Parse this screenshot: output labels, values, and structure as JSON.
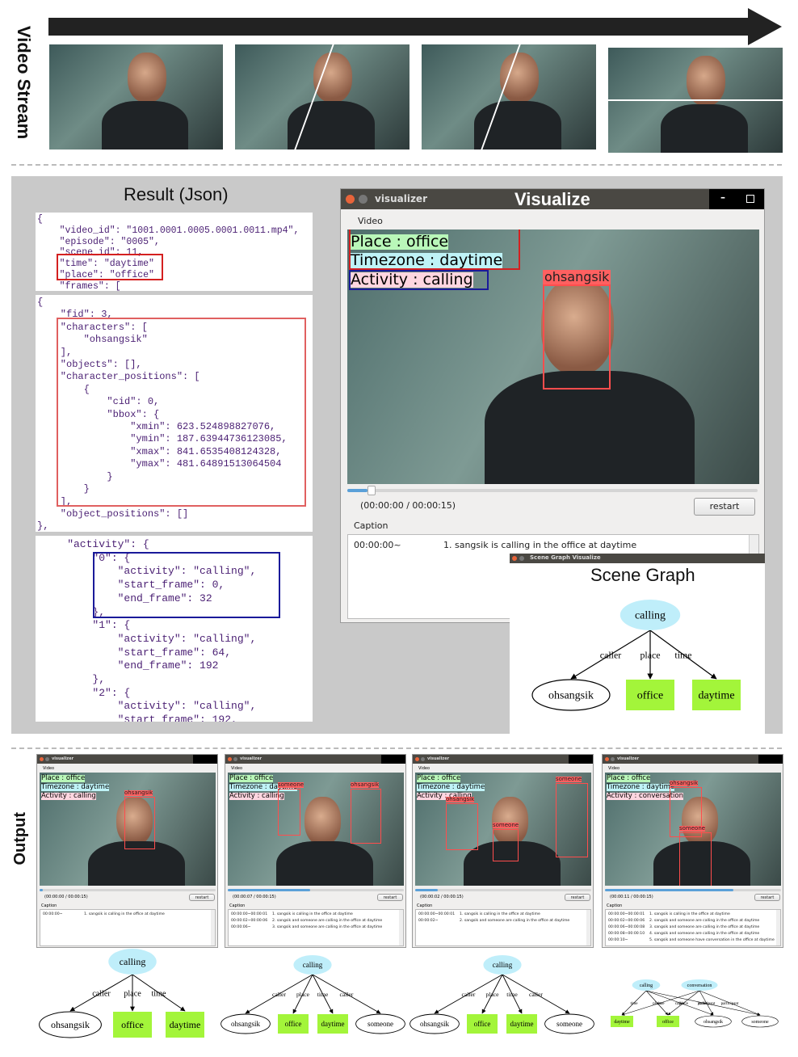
{
  "labels": {
    "video_stream": "Video Stream",
    "output": "Output",
    "result_json": "Result (Json)",
    "visualize": "Visualize",
    "scene_graph": "Scene Graph"
  },
  "json_result": {
    "box1": [
      "{",
      "    \"video_id\": \"1001.0001.0005.0001.0011.mp4\",",
      "    \"episode\": \"0005\",",
      "    \"scene_id\": 11,",
      "    \"time\": \"daytime\"",
      "    \"place\": \"office\"",
      "    \"frames\": ["
    ],
    "box2": [
      "{",
      "    \"fid\": 3,",
      "    \"characters\": [",
      "        \"ohsangsik\"",
      "    ],",
      "    \"objects\": [],",
      "    \"character_positions\": [",
      "        {",
      "            \"cid\": 0,",
      "            \"bbox\": {",
      "                \"xmin\": 623.524898827076,",
      "                \"ymin\": 187.63944736123085,",
      "                \"xmax\": 841.6535408124328,",
      "                \"ymax\": 481.64891513064504",
      "            }",
      "        }",
      "    ],",
      "    \"object_positions\": []",
      "},"
    ],
    "box3": [
      "    \"activity\": {",
      "        \"0\": {",
      "            \"activity\": \"calling\",",
      "            \"start_frame\": 0,",
      "            \"end_frame\": 32",
      "        },",
      "        \"1\": {",
      "            \"activity\": \"calling\",",
      "            \"start_frame\": 64,",
      "            \"end_frame\": 192",
      "        },",
      "        \"2\": {",
      "            \"activity\": \"calling\",",
      "            \"start_frame\": 192,"
    ]
  },
  "visualizer": {
    "window_title": "visualizer",
    "menu": "Video",
    "place": "Place : office",
    "timezone": "Timezone : daytime",
    "activity": "Activity : calling",
    "person": "ohsangsik",
    "time_readout": "(00:00:00 / 00:00:15)",
    "progress": 0.05,
    "restart": "restart",
    "caption_label": "Caption",
    "captions": [
      {
        "time": "00:00:00~",
        "text": "1. sangsik is calling in the office at daytime"
      }
    ]
  },
  "scene_graph_window": {
    "window_title": "Scene Graph Visualize"
  },
  "graph_main": {
    "nodes": [
      {
        "id": "calling",
        "type": "activity"
      },
      {
        "id": "ohsangsik",
        "type": "person"
      },
      {
        "id": "office",
        "type": "attr"
      },
      {
        "id": "daytime",
        "type": "attr"
      }
    ],
    "edges": [
      {
        "from": "calling",
        "to": "ohsangsik",
        "label": "caller"
      },
      {
        "from": "calling",
        "to": "office",
        "label": "place"
      },
      {
        "from": "calling",
        "to": "daytime",
        "label": "time"
      }
    ]
  },
  "outputs": [
    {
      "window_title": "visualizer",
      "menu": "Video",
      "place": "Place : office",
      "timezone": "Timezone : daytime",
      "activity": "Activity : calling",
      "persons": [
        "ohsangsik"
      ],
      "time_readout": "(00:00:00 / 00:00:15)",
      "progress": 0.02,
      "restart": "restart",
      "caption_label": "Caption",
      "captions": [
        {
          "time": "00:00:00~",
          "text": "1. sangsik is calling in the office at daytime"
        }
      ],
      "graph": {
        "nodes": [
          {
            "id": "calling",
            "type": "activity"
          },
          {
            "id": "ohsangsik",
            "type": "person"
          },
          {
            "id": "office",
            "type": "attr"
          },
          {
            "id": "daytime",
            "type": "attr"
          }
        ],
        "edges": [
          {
            "from": "calling",
            "to": "ohsangsik",
            "label": "caller"
          },
          {
            "from": "calling",
            "to": "office",
            "label": "place"
          },
          {
            "from": "calling",
            "to": "daytime",
            "label": "time"
          }
        ]
      }
    },
    {
      "window_title": "visualizer",
      "menu": "Video",
      "place": "Place : office",
      "timezone": "Timezone : daytime",
      "activity": "Activity : calling",
      "persons": [
        "someone",
        "ohsangsik"
      ],
      "time_readout": "(00:00:07 / 00:00:15)",
      "progress": 0.47,
      "restart": "restart",
      "caption_label": "Caption",
      "captions": [
        {
          "time": "00:00:00~00:00:01",
          "text": "1. sangsik is calling in the office at daytime"
        },
        {
          "time": "00:00:02~00:00:06",
          "text": "2. sangsik and someone are calling in the office at daytime"
        },
        {
          "time": "00:00:06~",
          "text": "3. sangsik and someone are calling in the office at daytime"
        }
      ],
      "graph": {
        "nodes": [
          {
            "id": "calling",
            "type": "activity"
          },
          {
            "id": "ohsangsik",
            "type": "person"
          },
          {
            "id": "office",
            "type": "attr"
          },
          {
            "id": "daytime",
            "type": "attr"
          },
          {
            "id": "someone",
            "type": "person"
          }
        ],
        "edges": [
          {
            "from": "calling",
            "to": "ohsangsik",
            "label": "caller"
          },
          {
            "from": "calling",
            "to": "office",
            "label": "place"
          },
          {
            "from": "calling",
            "to": "daytime",
            "label": "time"
          },
          {
            "from": "calling",
            "to": "someone",
            "label": "caller"
          }
        ]
      }
    },
    {
      "window_title": "visualizer",
      "menu": "Video",
      "place": "Place : office",
      "timezone": "Timezone : daytime",
      "activity": "Activity : calling",
      "persons": [
        "someone",
        "ohsangsik",
        "someone"
      ],
      "time_readout": "(00:00:02 / 00:00:15)",
      "progress": 0.13,
      "restart": "restart",
      "caption_label": "Caption",
      "captions": [
        {
          "time": "00:00:00~00:00:01",
          "text": "1. sangsik is calling in the office at daytime"
        },
        {
          "time": "00:00:02~",
          "text": "2. sangsik and someone are calling in the office at daytime"
        }
      ],
      "graph": {
        "nodes": [
          {
            "id": "calling",
            "type": "activity"
          },
          {
            "id": "ohsangsik",
            "type": "person"
          },
          {
            "id": "office",
            "type": "attr"
          },
          {
            "id": "daytime",
            "type": "attr"
          },
          {
            "id": "someone",
            "type": "person"
          }
        ],
        "edges": [
          {
            "from": "calling",
            "to": "ohsangsik",
            "label": "caller"
          },
          {
            "from": "calling",
            "to": "office",
            "label": "place"
          },
          {
            "from": "calling",
            "to": "daytime",
            "label": "time"
          },
          {
            "from": "calling",
            "to": "someone",
            "label": "caller"
          }
        ]
      }
    },
    {
      "window_title": "visualizer",
      "menu": "Video",
      "place": "Place : office",
      "timezone": "Timezone : daytime",
      "activity": "Activity : conversation",
      "persons": [
        "ohsangsik",
        "someone"
      ],
      "time_readout": "(00:00:11 / 00:00:15)",
      "progress": 0.73,
      "restart": "restart",
      "caption_label": "Caption",
      "captions": [
        {
          "time": "00:00:00~00:00:01",
          "text": "1. sangsik is calling in the office at daytime"
        },
        {
          "time": "00:00:02~00:00:06",
          "text": "2. sangsik and someone are calling in the office at daytime"
        },
        {
          "time": "00:00:06~00:00:08",
          "text": "3. sangsik and someone are calling in the office at daytime"
        },
        {
          "time": "00:00:08~00:00:10",
          "text": "4. sangsik and someone are calling in the office at daytime"
        },
        {
          "time": "00:00:10~",
          "text": "5. sangsik and someone have conversation in the office at daytime"
        }
      ],
      "graph": {
        "nodes": [
          {
            "id": "calling",
            "type": "activity"
          },
          {
            "id": "conversation",
            "type": "activity"
          },
          {
            "id": "daytime",
            "type": "attr"
          },
          {
            "id": "office",
            "type": "attr"
          },
          {
            "id": "ohsangsik",
            "type": "person"
          },
          {
            "id": "someone",
            "type": "person"
          }
        ],
        "edges": [
          {
            "from": "calling",
            "to": "daytime",
            "label": "time"
          },
          {
            "from": "calling",
            "to": "office",
            "label": "place"
          },
          {
            "from": "conversation",
            "to": "daytime",
            "label": "time"
          },
          {
            "from": "calling",
            "to": "ohsangsik",
            "label": "caller"
          },
          {
            "from": "conversation",
            "to": "office",
            "label": "place"
          },
          {
            "from": "calling",
            "to": "someone",
            "label": "caller"
          },
          {
            "from": "conversation",
            "to": "ohsangsik",
            "label": "participant"
          },
          {
            "from": "conversation",
            "to": "someone",
            "label": "participant"
          }
        ]
      }
    }
  ],
  "colors": {
    "activity_node": "#bfeefa",
    "attr_node": "#a3f53a",
    "person_node": "#ffffff",
    "place_bg": "#b9f7b9",
    "timezone_bg": "#bff3f7",
    "activity_bg": "#ffd6e0",
    "json_highlight_red": "#d42020",
    "json_highlight_blue": "#1a1a9a",
    "person_box": "#ff4d4d"
  },
  "icons": {
    "window_close": "close-icon",
    "window_minimize": "minimize-icon",
    "window_maximize": "maximize-icon",
    "arrow": "arrow-right-icon"
  }
}
